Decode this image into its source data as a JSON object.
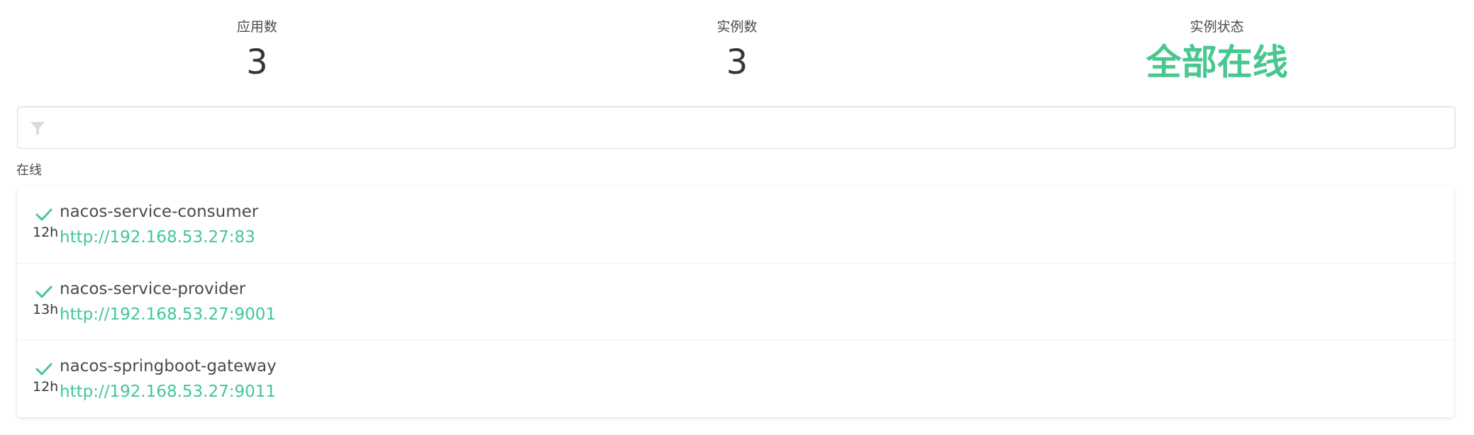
{
  "stats": {
    "applications": {
      "label": "应用数",
      "value": "3"
    },
    "instances": {
      "label": "实例数",
      "value": "3"
    },
    "status": {
      "label": "实例状态",
      "value": "全部在线"
    }
  },
  "filter": {
    "placeholder": "",
    "value": "",
    "icon": "filter-icon"
  },
  "group": {
    "label": "在线"
  },
  "colors": {
    "accent": "#48c78e",
    "link": "#42c795"
  },
  "apps": [
    {
      "status_icon": "check-icon",
      "age": "12h",
      "name": "nacos-service-consumer",
      "url": "http://192.168.53.27:83"
    },
    {
      "status_icon": "check-icon",
      "age": "13h",
      "name": "nacos-service-provider",
      "url": "http://192.168.53.27:9001"
    },
    {
      "status_icon": "check-icon",
      "age": "12h",
      "name": "nacos-springboot-gateway",
      "url": "http://192.168.53.27:9011"
    }
  ]
}
